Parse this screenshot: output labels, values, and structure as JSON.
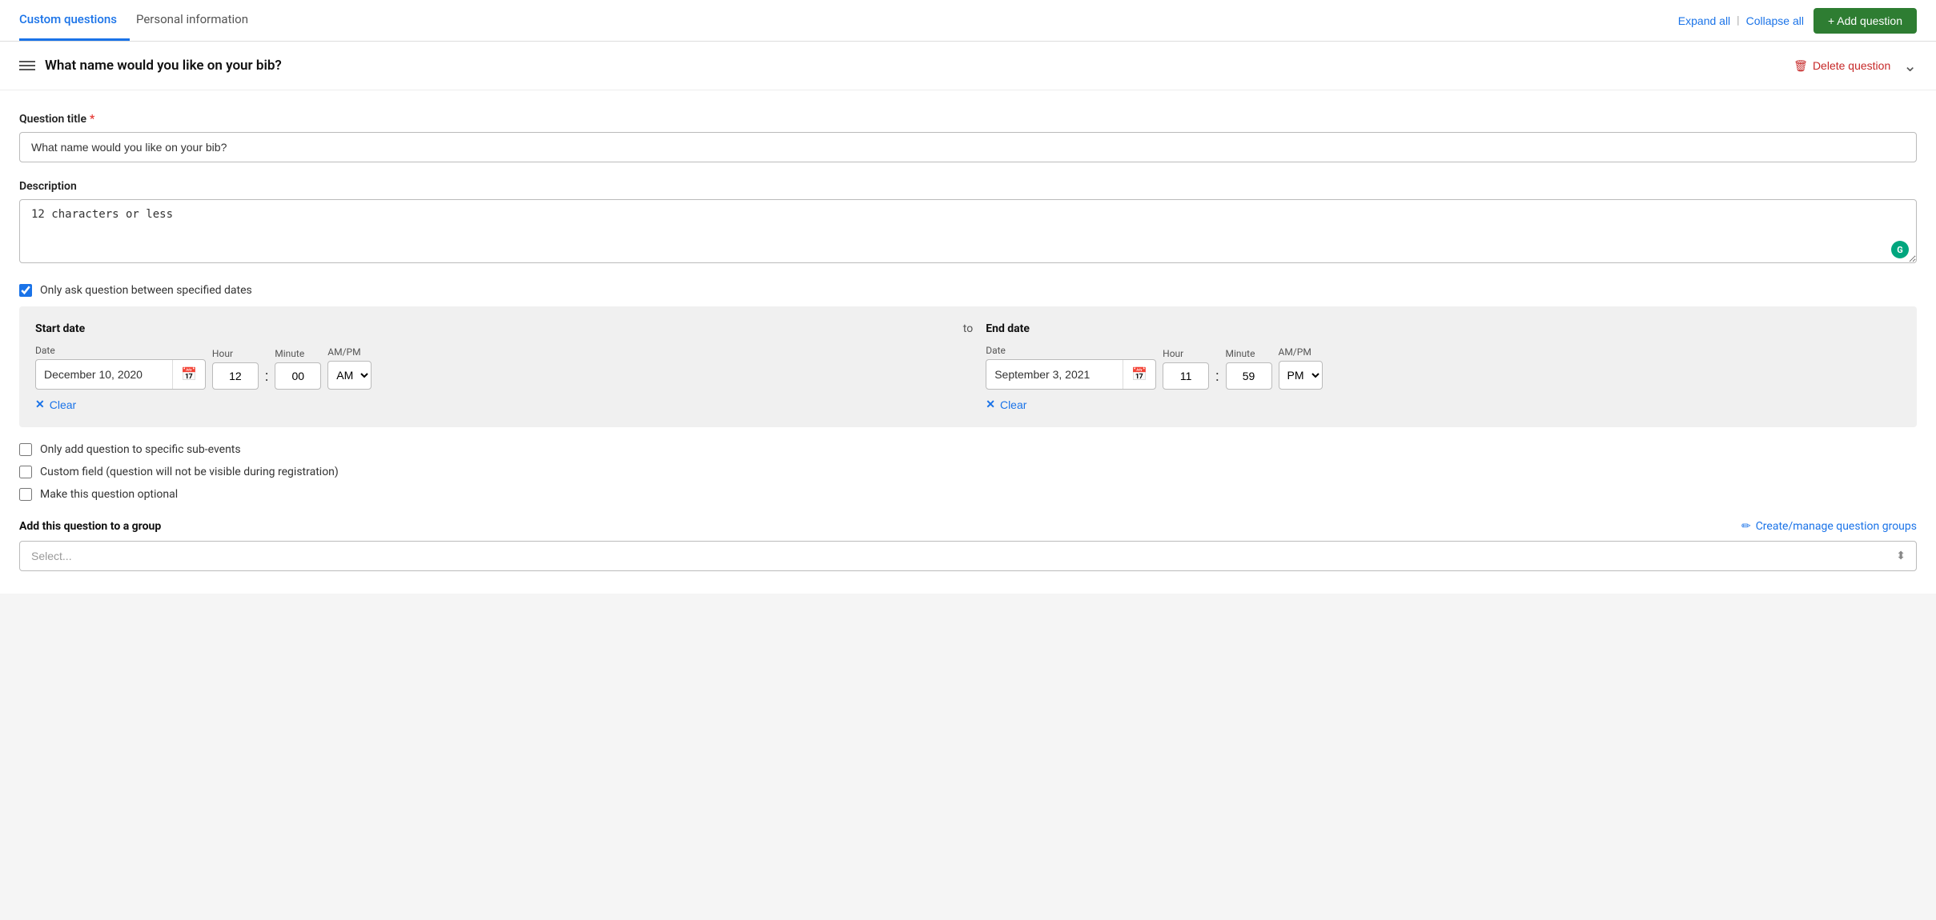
{
  "nav": {
    "tab_custom_questions": "Custom questions",
    "tab_personal_information": "Personal information",
    "expand_all": "Expand all",
    "collapse_all": "Collapse all",
    "add_question": "+ Add question"
  },
  "question": {
    "title": "What name would you like on your bib?",
    "delete_label": "Delete question",
    "drag_label": "drag handle"
  },
  "form": {
    "question_title_label": "Question title",
    "question_title_required": "*",
    "question_title_value": "What name would you like on your bib?",
    "description_label": "Description",
    "description_value": "12 characters or less",
    "date_range_checkbox_label": "Only ask question between specified dates",
    "start_date_title": "Start date",
    "start_date_date_label": "Date",
    "start_date_value": "December 10, 2020",
    "start_date_hour_label": "Hour",
    "start_date_hour_value": "12",
    "start_date_minute_label": "Minute",
    "start_date_minute_value": "00",
    "start_date_ampm_label": "AM/PM",
    "start_date_ampm_value": "AM",
    "start_clear_label": "Clear",
    "to_text": "to",
    "end_date_title": "End date",
    "end_date_date_label": "Date",
    "end_date_value": "September 3, 2021",
    "end_date_hour_label": "Hour",
    "end_date_hour_value": "11",
    "end_date_minute_label": "Minute",
    "end_date_minute_value": "59",
    "end_date_ampm_label": "AM/PM",
    "end_date_ampm_value": "PM",
    "end_clear_label": "Clear",
    "checkbox_sub_events": "Only add question to specific sub-events",
    "checkbox_custom_field": "Custom field (question will not be visible during registration)",
    "checkbox_optional": "Make this question optional",
    "group_label": "Add this question to a group",
    "create_manage_label": "Create/manage question groups",
    "select_placeholder": "Select..."
  },
  "icons": {
    "calendar": "📅",
    "delete_trash": "🗑",
    "clear_x": "✕",
    "pencil": "✏",
    "chevron_down": "⌄",
    "grammarly": "G"
  },
  "colors": {
    "active_tab": "#1a73e8",
    "add_button_bg": "#2e7d32",
    "delete_red": "#c62828",
    "link_blue": "#1a73e8"
  }
}
